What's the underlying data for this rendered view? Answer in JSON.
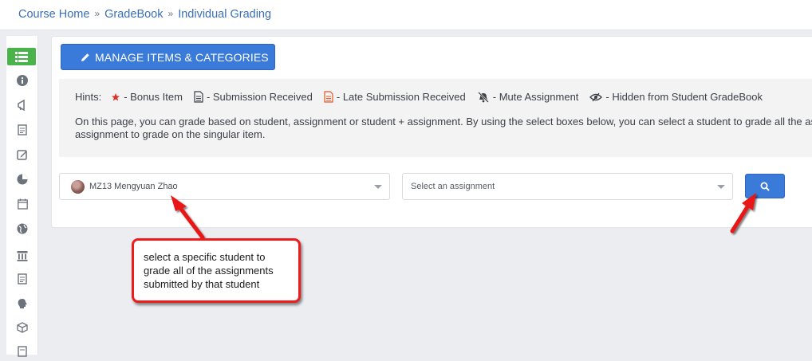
{
  "breadcrumb": {
    "items": [
      "Course Home",
      "GradeBook",
      "Individual Grading"
    ],
    "separator": "»"
  },
  "sidebar": {
    "items": [
      {
        "icon": "list-icon",
        "active": true
      },
      {
        "icon": "info-icon"
      },
      {
        "icon": "megaphone-icon"
      },
      {
        "icon": "document-icon"
      },
      {
        "icon": "edit-icon"
      },
      {
        "icon": "pie-chart-icon"
      },
      {
        "icon": "calendar-icon"
      },
      {
        "icon": "globe-icon"
      },
      {
        "icon": "building-icon"
      },
      {
        "icon": "document-icon"
      },
      {
        "icon": "brain-icon"
      },
      {
        "icon": "cube-icon"
      }
    ]
  },
  "toolbar": {
    "manage_label": "MANAGE ITEMS & CATEGORIES"
  },
  "hints": {
    "title": "Hints:",
    "items": [
      {
        "icon": "star-icon",
        "label": "- Bonus Item"
      },
      {
        "icon": "submission-icon",
        "label": "- Submission Received"
      },
      {
        "icon": "late-submission-icon",
        "label": "- Late Submission Received"
      },
      {
        "icon": "mute-icon",
        "label": "- Mute Assignment"
      },
      {
        "icon": "hidden-icon",
        "label": "- Hidden from Student GradeBook"
      }
    ],
    "description_line1": "On this page, you can grade based on student, assignment or student + assignment. By using the select boxes below, you can select a student to grade all the assignments",
    "description_line2": "assignment to grade on the singular item."
  },
  "filters": {
    "student_value": "MZ13 Mengyuan Zhao",
    "assignment_placeholder": "Select an assignment"
  },
  "callout": {
    "text": "select a specific student to grade all of the assignments submitted by that student"
  },
  "colors": {
    "primary": "#3a7ad8",
    "active_sidebar": "#4ab44a",
    "callout_border": "#ee1c1c",
    "link": "#3a6fb8"
  }
}
